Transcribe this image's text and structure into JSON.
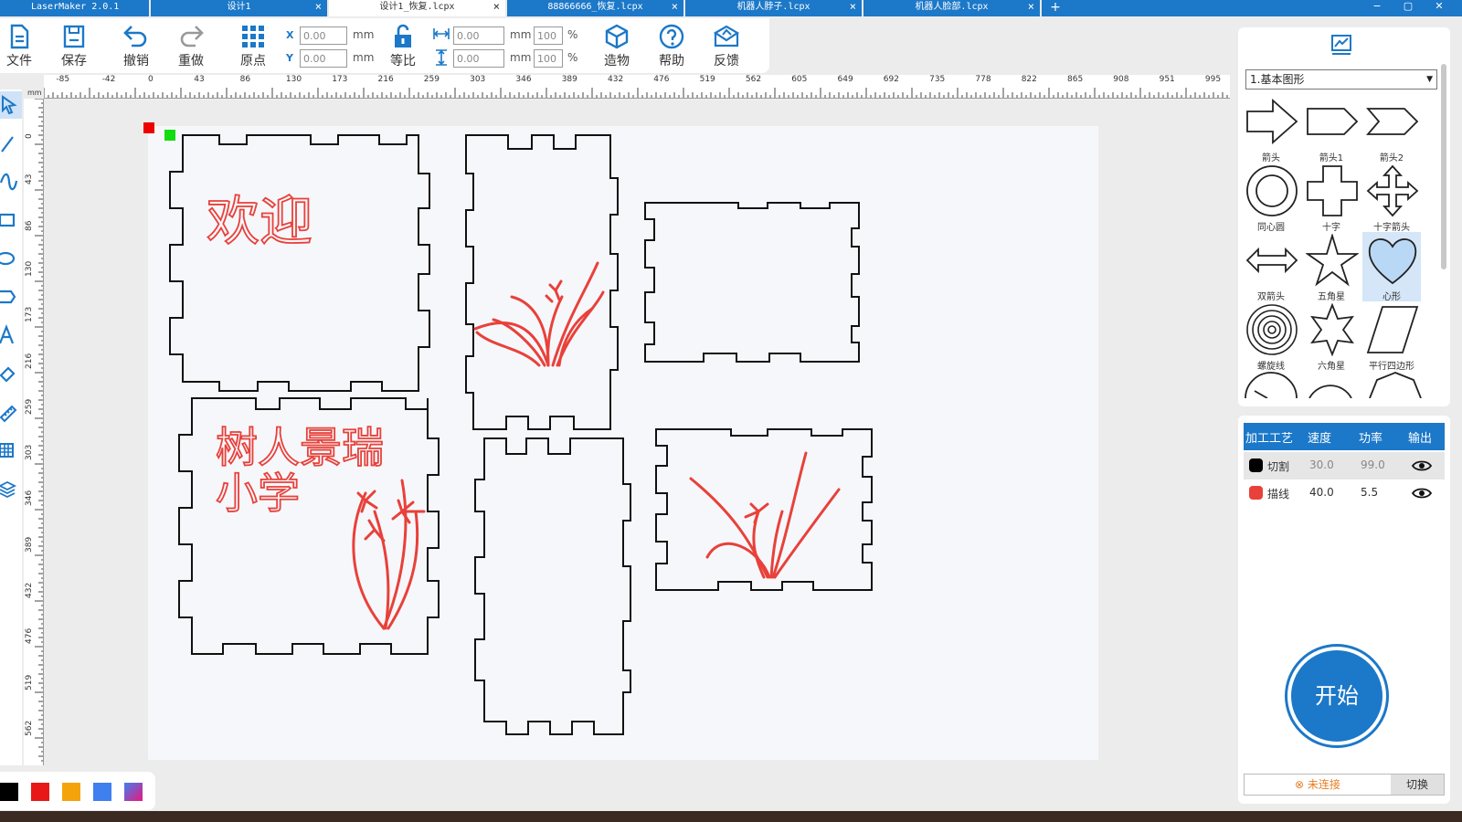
{
  "tabs": {
    "app": "LaserMaker 2.0.1",
    "items": [
      {
        "label": "设计1"
      },
      {
        "label": "设计1_恢复.lcpx"
      },
      {
        "label": "88866666_恢复.lcpx"
      },
      {
        "label": "机器人脖子.lcpx"
      },
      {
        "label": "机器人脸部.lcpx"
      }
    ],
    "close": "×",
    "add": "+",
    "min": "−",
    "max": "▢",
    "exit": "✕"
  },
  "toolbar": {
    "file": "文件",
    "save": "保存",
    "undo": "撤销",
    "redo": "重做",
    "origin": "原点",
    "ratio": "等比",
    "build": "造物",
    "help": "帮助",
    "feedback": "反馈",
    "x_label": "X",
    "y_label": "Y",
    "x_value": "0.00",
    "y_value": "0.00",
    "w_value": "0.00",
    "h_value": "0.00",
    "w_percent": "100",
    "h_percent": "100",
    "unit": "mm",
    "percent": "%"
  },
  "ruler": {
    "h_ticks": [
      "-85",
      "-42",
      "0",
      "43",
      "86",
      "130",
      "173",
      "216",
      "259",
      "303",
      "346",
      "389",
      "432",
      "476",
      "519",
      "562",
      "605",
      "649",
      "692",
      "735",
      "778",
      "822",
      "865",
      "908",
      "951",
      "995"
    ],
    "v_ticks": [
      "0",
      "43",
      "86",
      "130",
      "173",
      "216",
      "259",
      "303",
      "346",
      "389",
      "432",
      "476",
      "519",
      "562"
    ],
    "corner": "mm"
  },
  "canvas": {
    "text1": "欢迎",
    "text2": "树人景瑞",
    "text3": "小学"
  },
  "palette": {
    "colors": [
      "#000000",
      "#e81818",
      "#f5a30a",
      "#3f7ff0",
      "#8a5cf0"
    ]
  },
  "shapes": {
    "category": "1.基本图形",
    "items": [
      {
        "name": "箭头"
      },
      {
        "name": "箭头1"
      },
      {
        "name": "箭头2"
      },
      {
        "name": "同心圆"
      },
      {
        "name": "十字"
      },
      {
        "name": "十字箭头"
      },
      {
        "name": "双箭头"
      },
      {
        "name": "五角星"
      },
      {
        "name": "心形"
      },
      {
        "name": "螺旋线"
      },
      {
        "name": "六角星"
      },
      {
        "name": "平行四边形"
      }
    ]
  },
  "layers": {
    "headers": {
      "process": "加工工艺",
      "speed": "速度",
      "power": "功率",
      "output": "输出"
    },
    "rows": [
      {
        "name": "切割",
        "speed": "30.0",
        "power": "99.0",
        "color": "#000000"
      },
      {
        "name": "描线",
        "speed": "40.0",
        "power": "5.5",
        "color": "#e8413a"
      }
    ],
    "start": "开始",
    "status": "未连接",
    "switch": "切换"
  }
}
